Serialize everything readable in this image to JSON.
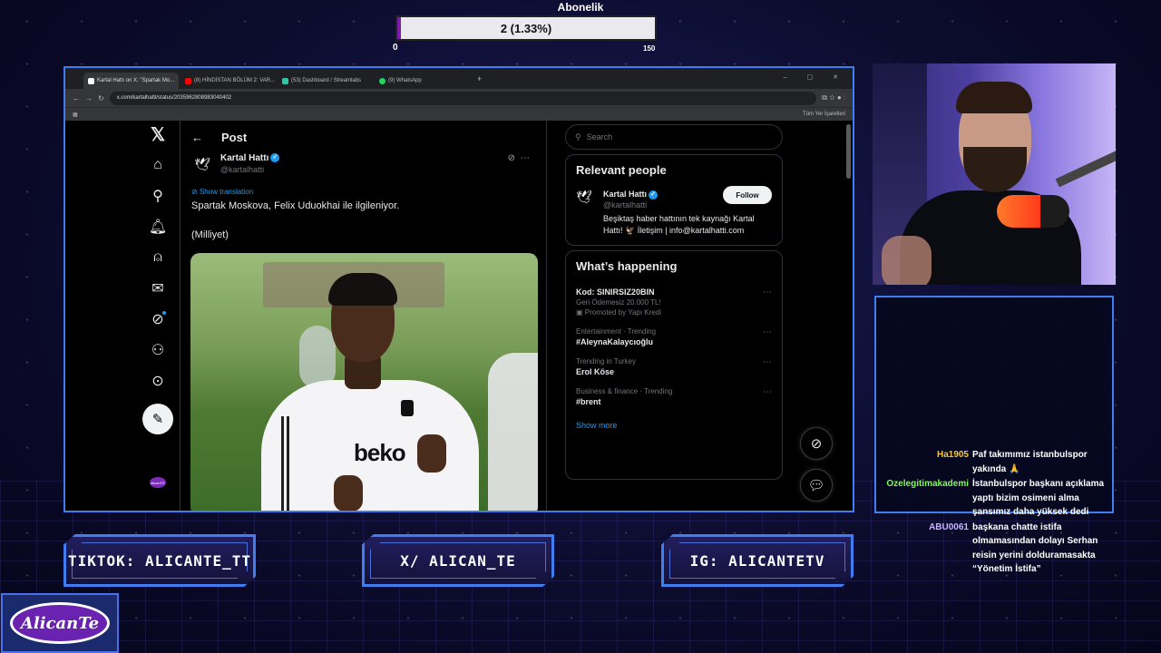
{
  "sub_goal": {
    "title": "Abonelik",
    "current_text": "2 (1.33%)",
    "progress_percent": 1.33,
    "min": "0",
    "max": "150"
  },
  "browser": {
    "tabs": [
      {
        "label": "Kartal Hattı on X: \"Spartak Mo...",
        "color": "#ffffff",
        "active": true
      },
      {
        "label": "(8) HİNDİSTAN BÖLÜM 2: VAR...",
        "color": "#ff0000",
        "active": false
      },
      {
        "label": "(53) Dashboard / Streamlabs",
        "color": "#31c3a2",
        "active": false
      },
      {
        "label": "(9) WhatsApp",
        "color": "#25d366",
        "active": false
      }
    ],
    "new_tab": "+",
    "url": "x.com/kartalhatti/status/2035962808983040402",
    "bookmark_right": "Tüm Yer İşaretleri"
  },
  "x_nav": {
    "items": [
      "x-logo",
      "home-icon",
      "search-icon",
      "notifications-icon",
      "follow-icon",
      "messages-icon",
      "grok-icon",
      "profile-icon",
      "more-icon"
    ],
    "compose": "compose-icon",
    "avatar_text": "alicanTE"
  },
  "post": {
    "header": "Post",
    "back": "←",
    "author_name": "Kartal Hattı",
    "author_handle": "@kartalhatti",
    "translate": "Show translation",
    "text": "Spartak Moskova, Felix Uduokhai ile ilgileniyor.\n\n(Milliyet)",
    "photo_sponsor": "beko"
  },
  "sidebar": {
    "search_placeholder": "Search",
    "relevant_title": "Relevant people",
    "person": {
      "name": "Kartal Hattı",
      "handle": "@kartalhatti",
      "bio": "Beşiktaş haber hattının tek kaynağı Kartal Hattı! 🦅 İletişim | info@kartalhatti.com",
      "follow_label": "Follow"
    },
    "happening_title": "What’s happening",
    "trends": [
      {
        "meta": "",
        "title": "Kod: SINIRSIZ20BIN",
        "sub": "Geri Ödemesiz 20.000 TL!",
        "promo": "Promoted by Yapı Kredi"
      },
      {
        "meta": "Entertainment · Trending",
        "title": "#AleynaKalaycıoğlu",
        "sub": "",
        "promo": ""
      },
      {
        "meta": "Trending in Turkey",
        "title": "Erol Köse",
        "sub": "",
        "promo": ""
      },
      {
        "meta": "Business & finance · Trending",
        "title": "#brent",
        "sub": "",
        "promo": ""
      }
    ],
    "show_more": "Show more"
  },
  "chat": [
    {
      "user": "Ha1905",
      "color": "#f4c542",
      "text": "Paf takımımız istanbulspor yakında 🙏"
    },
    {
      "user": "Ozelegitimakademi",
      "color": "#7cff4f",
      "text": "İstanbulspor başkanı açıklama yaptı bizim osimeni alma şansımız daha yüksek dedi"
    },
    {
      "user": "ABU0061",
      "color": "#c7b4ff",
      "text": "başkana chatte istifa olmamasından dolayı Serhan reisin yerini dolduramasakta “Yönetim İstifa”"
    }
  ],
  "socials": [
    "TIKTOK: ALICANTE_TT",
    "X/ ALICAN_TE",
    "IG: ALICANTETV"
  ],
  "logo_text": "AlicanTe",
  "colors": {
    "accent": "#3f7df0",
    "x_blue": "#1d9bf0",
    "goal_fill": "#7a1cae"
  }
}
